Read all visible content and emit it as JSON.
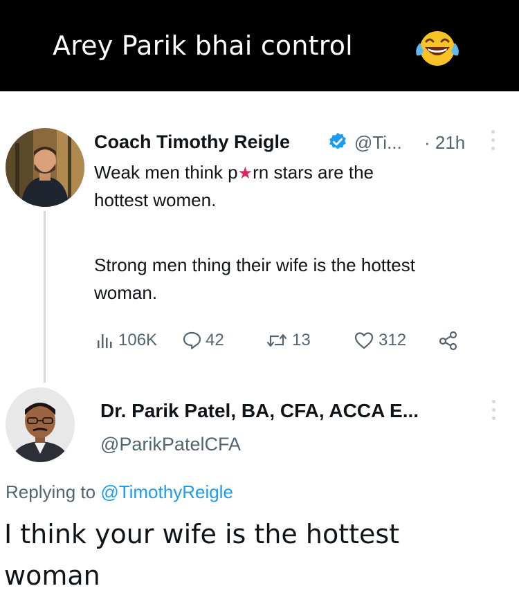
{
  "caption": {
    "text": "Arey Parik bhai control",
    "emoji_icon": "face-with-tears-of-joy-icon"
  },
  "original_tweet": {
    "author_name": "Coach Timothy Reigle",
    "verified_icon": "verified-badge-icon",
    "handle": "@Ti...",
    "time": "· 21h",
    "lines": [
      "Weak men think p",
      "rn stars are the",
      "hottest women.",
      "Strong men thing their wife is the hottest",
      "woman."
    ],
    "censor_glyph": "★",
    "stats": {
      "views": "106K",
      "replies": "42",
      "retweets": "13",
      "likes": "312"
    }
  },
  "reply_tweet": {
    "author_name": "Dr. Parik Patel, BA, CFA, ACCA E...",
    "handle": "@ParikPatelCFA",
    "replying_prefix": "Replying to",
    "replying_to": "@TimothyReigle",
    "lines": [
      "I think your wife is the hottest",
      "woman"
    ]
  },
  "colors": {
    "banner_bg": "#000000",
    "banner_text": "#ffffff",
    "text_primary": "#0f1419",
    "text_secondary": "#536471",
    "link": "#1d9bf0",
    "verified": "#1d9bf0",
    "censor_star": "#e0245e",
    "divider": "#cfd9de"
  }
}
